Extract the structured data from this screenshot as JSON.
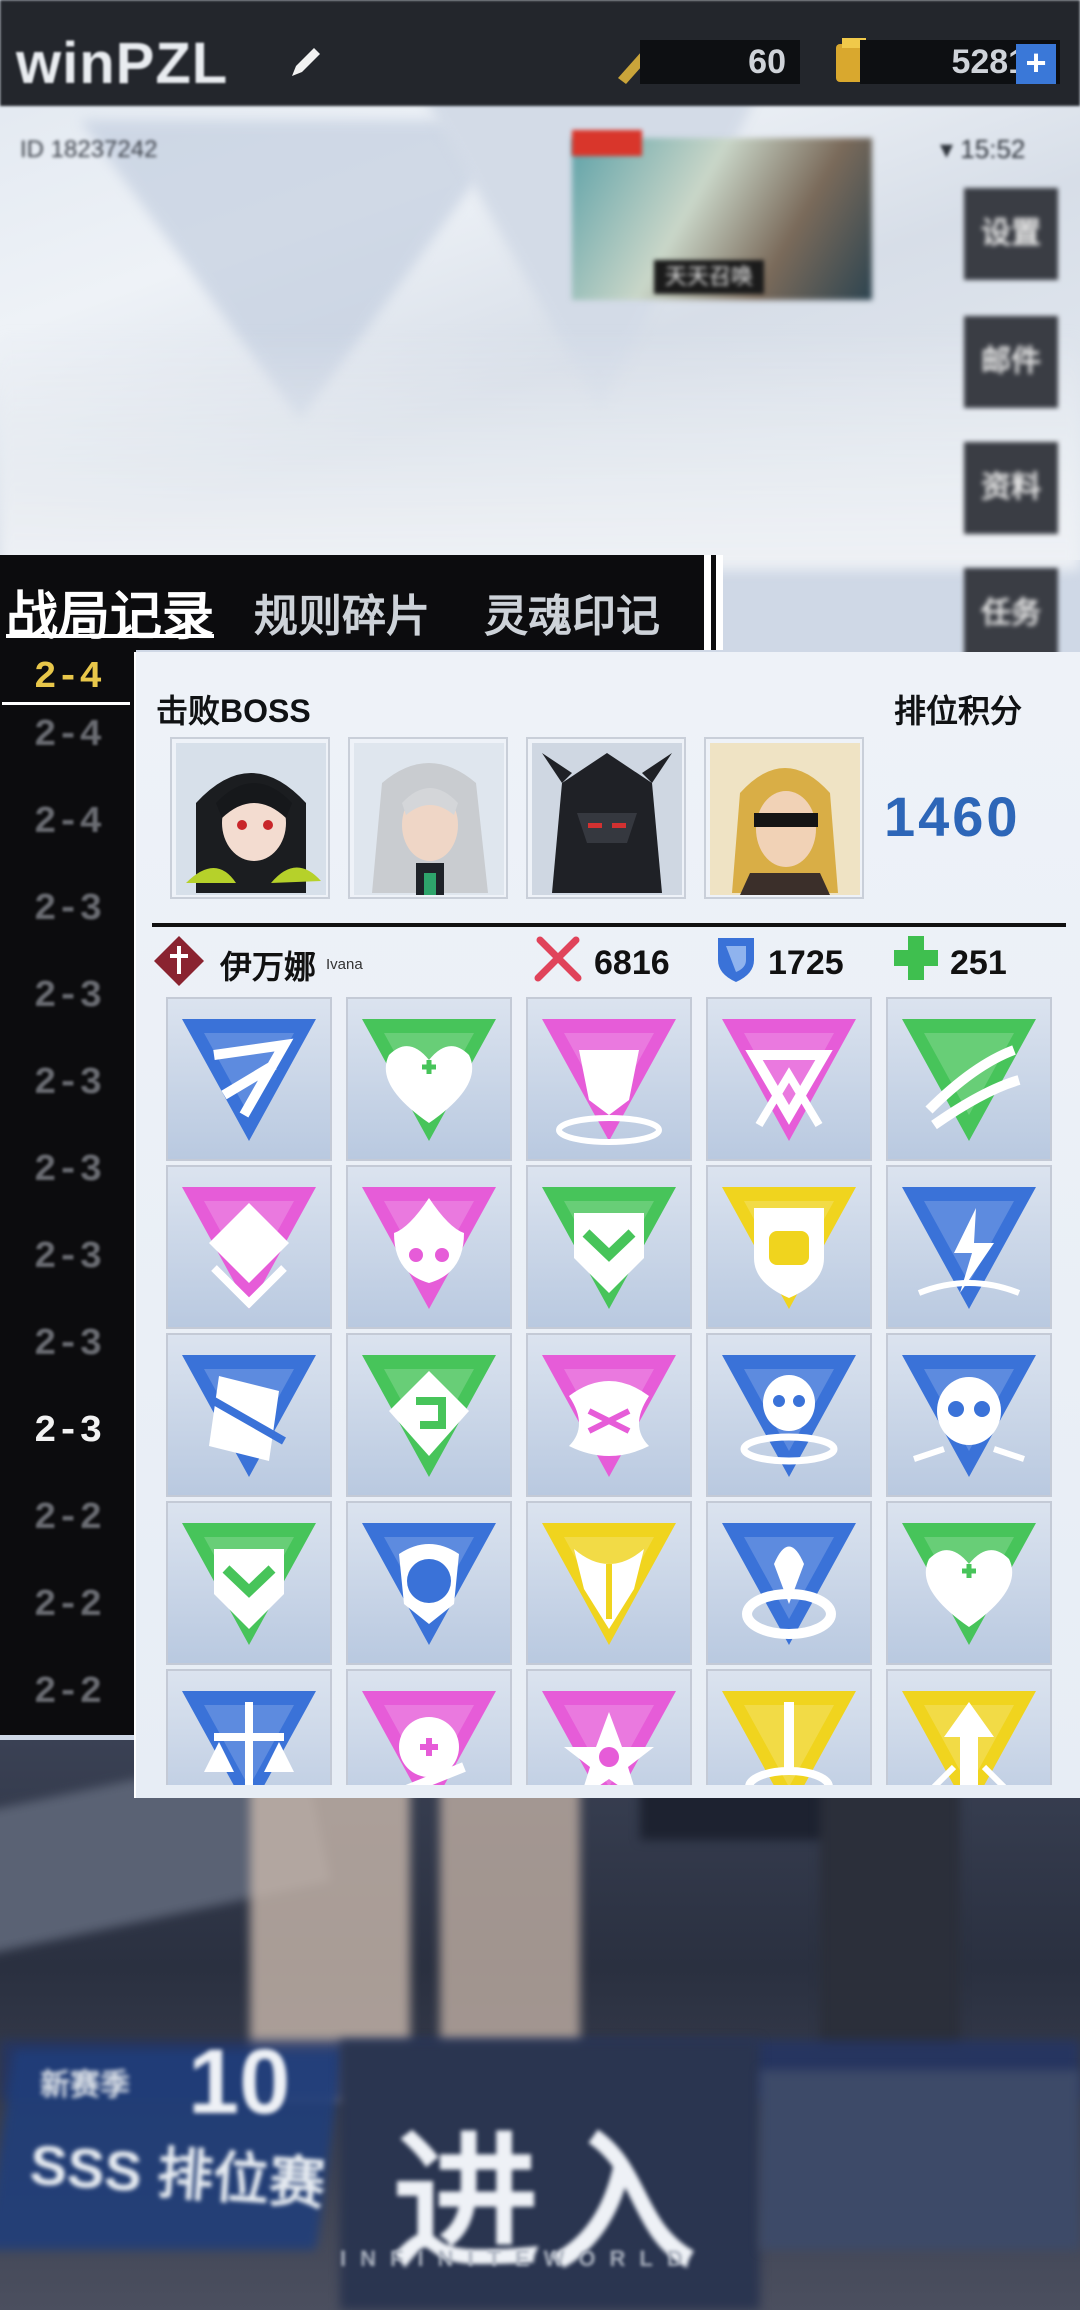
{
  "header": {
    "player_name": "winPZL",
    "stamina": "60",
    "gold": "52816",
    "gold_plus": "+",
    "player_id": "ID 18237242",
    "time": "15:52",
    "event_label": "天天召唤"
  },
  "side_buttons": [
    "设置",
    "邮件",
    "资料",
    "任务"
  ],
  "tabs": {
    "records": "战局记录",
    "fragments": "规则碎片",
    "souls": "灵魂印记"
  },
  "stages": {
    "current": "2-4",
    "list": [
      "2-4",
      "2-4",
      "2-3",
      "2-3",
      "2-3",
      "2-3",
      "2-3",
      "2-3",
      "2-3",
      "2-2",
      "2-2",
      "2-2"
    ]
  },
  "record": {
    "boss_label": "击败BOSS",
    "rank_label": "排位积分",
    "rank_score": "1460",
    "bosses": [
      "boss-dragon-girl",
      "boss-silver-hair",
      "boss-dark-knight",
      "boss-blindfold"
    ],
    "character": {
      "name": "伊万娜",
      "name_en": "Ivana",
      "attack": "6816",
      "defense": "1725",
      "hp": "251"
    }
  },
  "cards": [
    {
      "color": "#3a72d8",
      "icon": "slash-rune-icon"
    },
    {
      "color": "#47c45a",
      "icon": "heart-up-icon"
    },
    {
      "color": "#e65cd8",
      "icon": "mask-icon"
    },
    {
      "color": "#e65cd8",
      "icon": "double-triangle-icon"
    },
    {
      "color": "#47c45a",
      "icon": "claw-icon"
    },
    {
      "color": "#e65cd8",
      "icon": "diamond-stack-icon"
    },
    {
      "color": "#e65cd8",
      "icon": "flame-skull-icon"
    },
    {
      "color": "#47c45a",
      "icon": "chevron-shield-icon"
    },
    {
      "color": "#f0d41e",
      "icon": "fist-shield-icon"
    },
    {
      "color": "#3a72d8",
      "icon": "lightning-icon"
    },
    {
      "color": "#3a72d8",
      "icon": "broken-card-icon"
    },
    {
      "color": "#47c45a",
      "icon": "spiral-icon"
    },
    {
      "color": "#e65cd8",
      "icon": "rune-swirl-icon"
    },
    {
      "color": "#3a72d8",
      "icon": "skull-ring-icon"
    },
    {
      "color": "#3a72d8",
      "icon": "skull-spark-icon"
    },
    {
      "color": "#47c45a",
      "icon": "chevron-shield-icon"
    },
    {
      "color": "#3a72d8",
      "icon": "demon-skull-icon"
    },
    {
      "color": "#f0d41e",
      "icon": "trident-icon"
    },
    {
      "color": "#3a72d8",
      "icon": "sprout-ring-icon"
    },
    {
      "color": "#47c45a",
      "icon": "heart-up-icon"
    },
    {
      "color": "#3a72d8",
      "icon": "scales-icon"
    },
    {
      "color": "#e65cd8",
      "icon": "flower-plus-icon"
    },
    {
      "color": "#e65cd8",
      "icon": "star-eye-icon"
    },
    {
      "color": "#f0d41e",
      "icon": "sword-ring-icon"
    },
    {
      "color": "#f0d41e",
      "icon": "arrow-up-icon"
    }
  ],
  "bottom": {
    "season_line1": "新赛季",
    "season_num": "10",
    "season_line2": "SSS 排位赛",
    "enter": "进入",
    "enter_sub": "INFINITEWORLD"
  }
}
